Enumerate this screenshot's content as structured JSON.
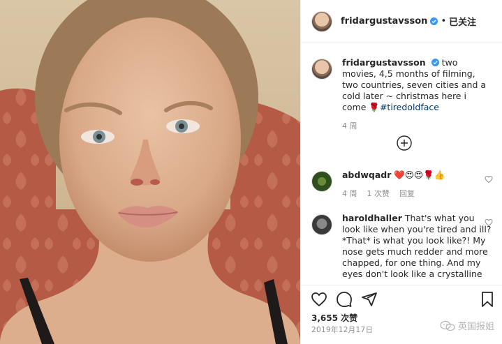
{
  "header": {
    "username": "fridargustavsson",
    "separator": "•",
    "follow_status": "已关注"
  },
  "caption": {
    "username": "fridargustavsson",
    "text_before": " two movies, 4,5 months of filming, two countries, seven cities and a cold later ~ christmas here i come ",
    "emoji": "🌹",
    "hashtag": "#tiredoldface",
    "time": "4 周"
  },
  "comments": [
    {
      "username": "abdwqadr",
      "text": " ❤️😍😍🌹👍",
      "time": "4 周",
      "likes": "1 次赞",
      "reply": "回复"
    },
    {
      "username": "haroldhaller",
      "text": " That's what you look like when you're tired and ill? *That* is what you look like?! My nose gets much redder and more chapped, for one thing. And my eyes don't look like a crystalline"
    }
  ],
  "actions": {
    "like_count": "3,655 次赞",
    "date": "2019年12月17日"
  },
  "watermark": {
    "text": "英国报姐"
  },
  "colors": {
    "verified_blue": "#3897f0",
    "hashtag_blue": "#00376b",
    "muted_gray": "#8e8e8e"
  },
  "icons": [
    "verified-badge-icon",
    "add-circle-icon",
    "heart-icon",
    "comment-icon",
    "share-icon",
    "bookmark-icon",
    "wechat-icon"
  ]
}
